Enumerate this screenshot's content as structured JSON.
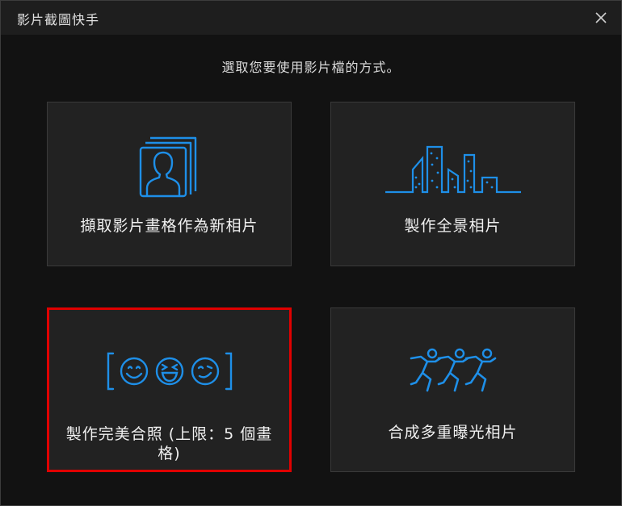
{
  "window": {
    "title": "影片截圖快手"
  },
  "prompt": "選取您要使用影片檔的方式。",
  "options": [
    {
      "label": "擷取影片畫格作為新相片",
      "icon": "portrait-frame-icon"
    },
    {
      "label": "製作全景相片",
      "icon": "city-skyline-icon"
    },
    {
      "label": "製作完美合照 (上限：5 個畫格)",
      "icon": "smiley-faces-icon",
      "selected": true
    },
    {
      "label": "合成多重曝光相片",
      "icon": "running-figures-icon"
    }
  ],
  "colors": {
    "accent": "#1e8fe8",
    "selection": "#e00000",
    "card": "#222222",
    "background": "#121212"
  }
}
